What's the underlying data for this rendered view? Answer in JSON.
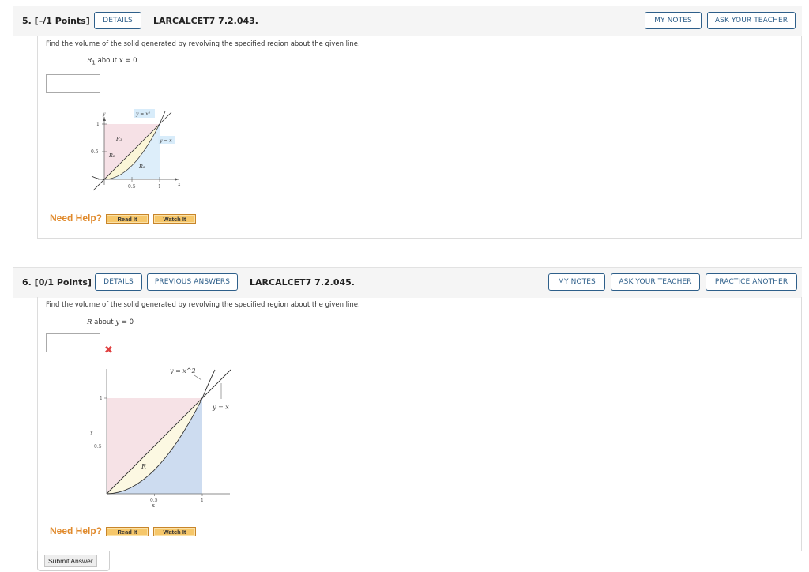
{
  "questions": [
    {
      "number_label": "5. [–/1 Points]",
      "details_label": "DETAILS",
      "code": "LARCALCET7 7.2.043.",
      "my_notes_label": "MY NOTES",
      "ask_teacher_label": "ASK YOUR TEACHER",
      "prompt": "Find the volume of the solid generated by revolving the specified region about the given line.",
      "region": "R",
      "region_sub": "1",
      "about_text": " about ",
      "axis_var": "x",
      "axis_eq": " = 0",
      "answer_value": "",
      "need_help_label": "Need Help?",
      "read_it_label": "Read It",
      "watch_it_label": "Watch It",
      "figure": {
        "y_axis_label": "y",
        "x_axis_label": "x",
        "y_ticks": [
          "1",
          "0.5"
        ],
        "x_ticks": [
          "0.5",
          "1"
        ],
        "curve_label_1": "y = x²",
        "curve_label_2": "y = x",
        "region_labels": [
          "R₁",
          "R₂",
          "R₃"
        ],
        "colors": {
          "r1": "#f6e1e6",
          "r2": "#fbf6d8",
          "r3": "#ddeefa",
          "label_bg": "#d8ecfa"
        }
      }
    },
    {
      "number_label": "6. [0/1 Points]",
      "details_label": "DETAILS",
      "prev_answers_label": "PREVIOUS ANSWERS",
      "code": "LARCALCET7 7.2.045.",
      "my_notes_label": "MY NOTES",
      "ask_teacher_label": "ASK YOUR TEACHER",
      "practice_label": "PRACTICE ANOTHER",
      "prompt": "Find the volume of the solid generated by revolving the specified region about the given line.",
      "region": "R",
      "about_text": " about ",
      "axis_var": "y",
      "axis_eq": " = 0",
      "answer_value": "",
      "answer_status": "incorrect",
      "need_help_label": "Need Help?",
      "read_it_label": "Read It",
      "watch_it_label": "Watch It",
      "figure": {
        "y_axis_label": "y",
        "x_axis_label": "x",
        "y_ticks": [
          "1",
          "0.5"
        ],
        "x_ticks": [
          "0.5",
          "1"
        ],
        "curve_label_1": "y = x^2",
        "curve_label_2": "y = x",
        "region_label": "R",
        "colors": {
          "upper": "#f6e2e6",
          "middle": "#fcf8e2",
          "lower": "#cddcf0"
        }
      }
    }
  ],
  "submit_label": "Submit Answer",
  "colors": {
    "accent": "#2e5f8a",
    "help": "#e08a2c",
    "wrong": "#e04040"
  }
}
